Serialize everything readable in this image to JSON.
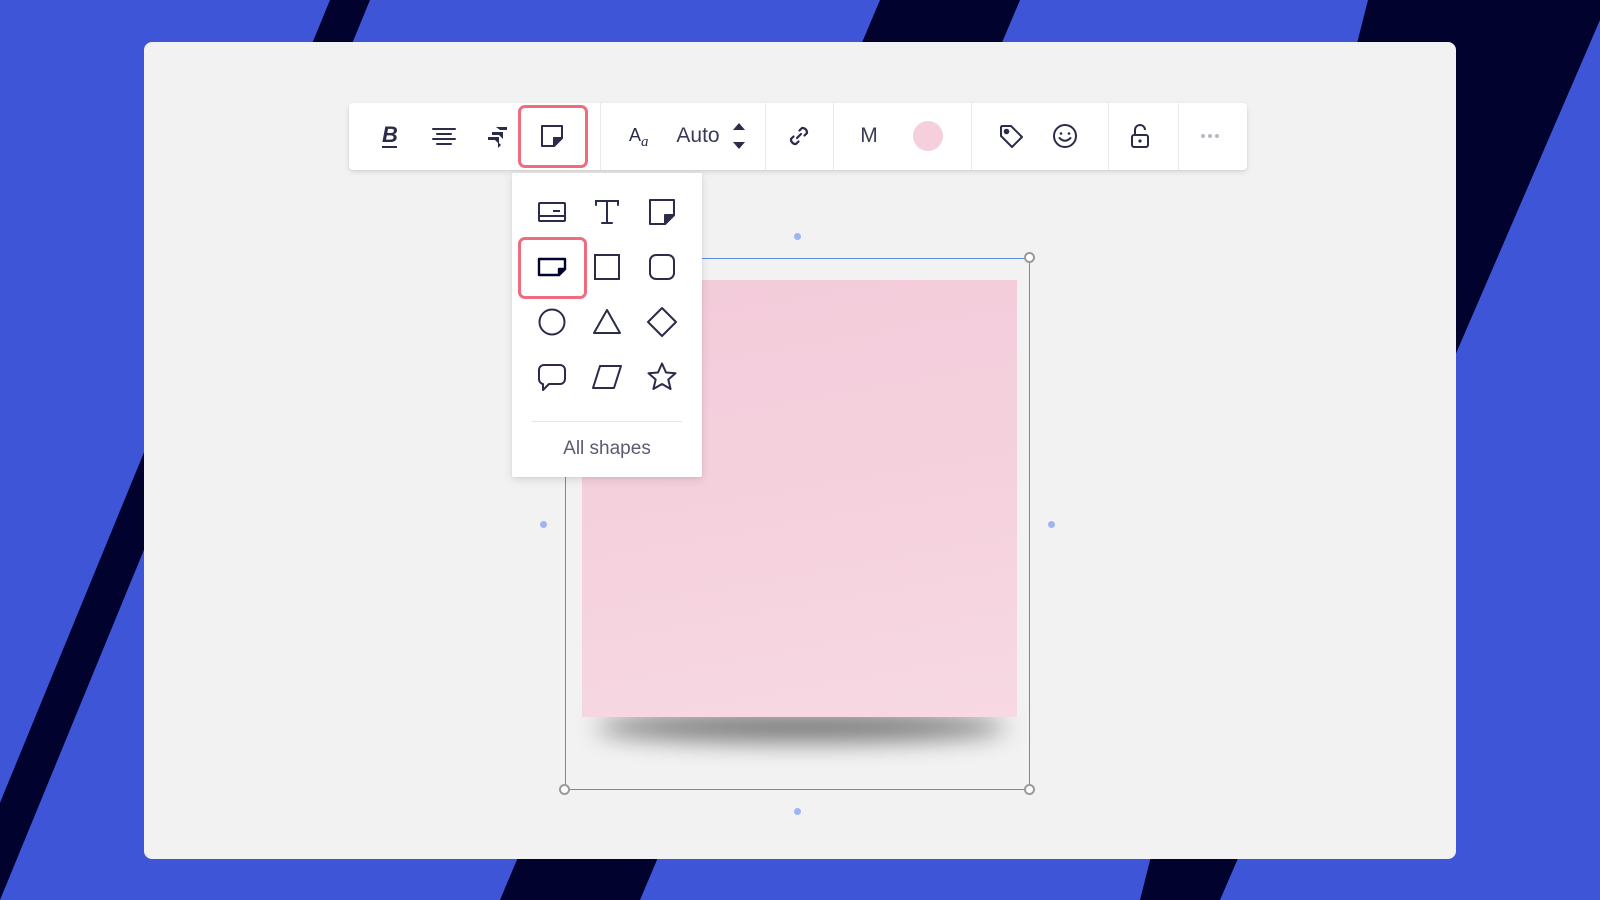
{
  "colors": {
    "background_blue": "#3d55d6",
    "background_navy": "#02022e",
    "canvas": "#f2f2f2",
    "highlight": "#ef6b7d",
    "icon": "#2b2b4a",
    "note_color": "#f5cfdc",
    "selection": "#5a8ae6"
  },
  "toolbar": {
    "items": [
      {
        "icon": "bold-icon"
      },
      {
        "icon": "align-center-icon"
      },
      {
        "icon": "jira-icon"
      },
      {
        "icon": "sticky-note-icon",
        "selected": true
      },
      {
        "icon": "font-size-icon"
      },
      {
        "icon": "link-icon"
      },
      {
        "icon": "tag-icon"
      },
      {
        "icon": "emoji-icon"
      },
      {
        "icon": "unlock-icon"
      },
      {
        "icon": "more-icon"
      }
    ],
    "font_size_value": "Auto",
    "note_size_label": "M"
  },
  "shape_menu": {
    "shapes": [
      {
        "icon": "card-icon"
      },
      {
        "icon": "text-icon"
      },
      {
        "icon": "sticky-note-square-icon"
      },
      {
        "icon": "sticky-note-rect-icon",
        "selected": true
      },
      {
        "icon": "square-icon"
      },
      {
        "icon": "rounded-square-icon"
      },
      {
        "icon": "circle-icon"
      },
      {
        "icon": "triangle-icon"
      },
      {
        "icon": "diamond-icon"
      },
      {
        "icon": "speech-bubble-icon"
      },
      {
        "icon": "parallelogram-icon"
      },
      {
        "icon": "star-icon"
      }
    ],
    "all_shapes_label": "All shapes"
  }
}
